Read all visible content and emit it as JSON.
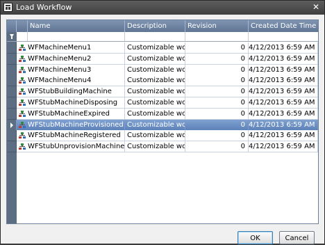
{
  "window": {
    "title": "Load Workflow",
    "close_label": "✕"
  },
  "grid": {
    "columns": [
      "Name",
      "Description",
      "Revision",
      "Created Date Time"
    ],
    "rows": [
      {
        "name": "WFMachineMenu1",
        "description": "Customizable workfl...",
        "revision": "0",
        "created": "4/12/2013 6:59 AM"
      },
      {
        "name": "WFMachineMenu2",
        "description": "Customizable workfl...",
        "revision": "0",
        "created": "4/12/2013 6:59 AM"
      },
      {
        "name": "WFMachineMenu3",
        "description": "Customizable workfl...",
        "revision": "0",
        "created": "4/12/2013 6:59 AM"
      },
      {
        "name": "WFMachineMenu4",
        "description": "Customizable workfl...",
        "revision": "0",
        "created": "4/12/2013 6:59 AM"
      },
      {
        "name": "WFStubBuildingMachine",
        "description": "Customizable workfl...",
        "revision": "0",
        "created": "4/12/2013 6:59 AM"
      },
      {
        "name": "WFStubMachineDisposing",
        "description": "Customizable workfl...",
        "revision": "0",
        "created": "4/12/2013 6:59 AM"
      },
      {
        "name": "WFStubMachineExpired",
        "description": "Customizable workfl...",
        "revision": "0",
        "created": "4/12/2013 6:59 AM"
      },
      {
        "name": "WFStubMachineProvisioned",
        "description": "Customizable workfl...",
        "revision": "0",
        "created": "4/12/2013 6:59 AM"
      },
      {
        "name": "WFStubMachineRegistered",
        "description": "Customizable workfl...",
        "revision": "0",
        "created": "4/12/2013 6:59 AM"
      },
      {
        "name": "WFStubUnprovisionMachine",
        "description": "Customizable workfl...",
        "revision": "0",
        "created": "4/12/2013 6:59 AM"
      }
    ],
    "selected_row": "WFStubMachineProvisioned"
  },
  "buttons": {
    "ok": "OK",
    "cancel": "Cancel"
  },
  "icons": {
    "row": "workflow-icon",
    "filter": "filter-icon",
    "selector": "row-selector-arrow-icon"
  },
  "colors": {
    "header": "#6b809d",
    "selection": "#6f93c7",
    "titlebar": "#4a4a4a"
  }
}
